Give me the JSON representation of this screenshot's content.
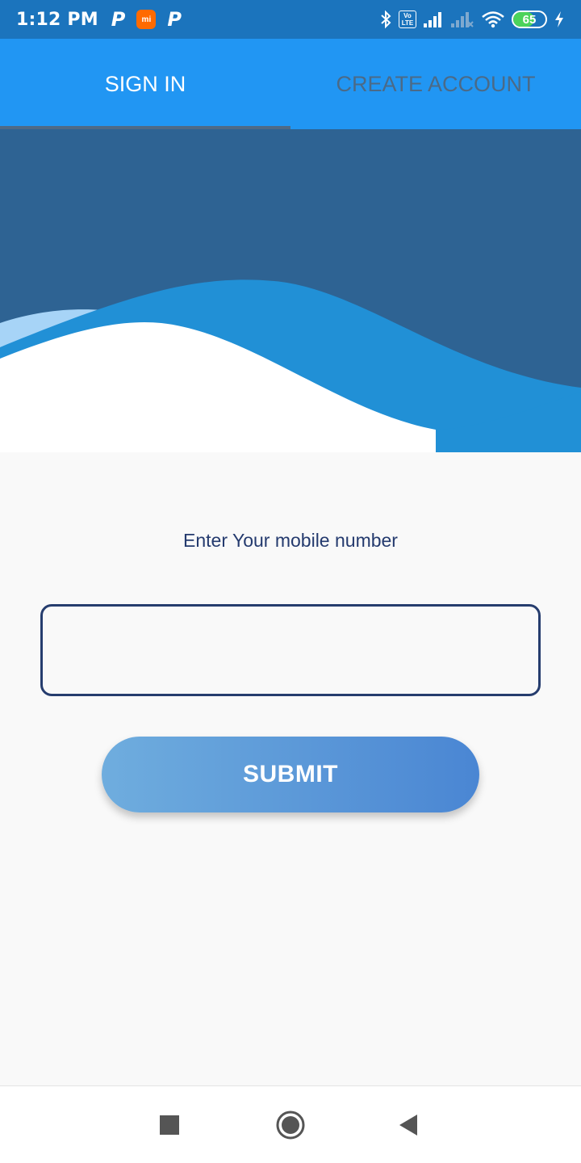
{
  "status_bar": {
    "time": "1:12 PM",
    "left_icons": [
      "p-app-icon",
      "mi-icon",
      "p-app-icon"
    ],
    "mi_label": "mi",
    "p_label": "P",
    "volte_label": "Vo LTE",
    "battery_level": "65",
    "battery_fraction": 0.65,
    "right_icons": [
      "bluetooth-icon",
      "volte-icon",
      "signal-icon",
      "signal-no-service-icon",
      "wifi-icon",
      "battery-icon",
      "charging-icon"
    ]
  },
  "tabs": [
    {
      "label": "SIGN IN",
      "active": true
    },
    {
      "label": "CREATE ACCOUNT",
      "active": false
    }
  ],
  "form": {
    "prompt": "Enter Your mobile number",
    "phone_value": "",
    "phone_placeholder": "",
    "submit_label": "SUBMIT"
  },
  "nav_bar": {
    "buttons": [
      "recents-square-icon",
      "home-circle-icon",
      "back-triangle-icon"
    ]
  },
  "colors": {
    "status_bar": "#1b74bd",
    "tab_bar": "#2196f3",
    "hero_dark": "#2e6393",
    "wave_mid": "#2190d6",
    "wave_light": "#a7d4f7",
    "form_text": "#243a6e",
    "button_gradient_start": "#6fadde",
    "button_gradient_end": "#4a86d3"
  }
}
